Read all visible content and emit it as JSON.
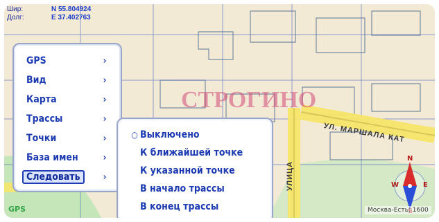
{
  "coords": {
    "lat_label": "Шир:",
    "lat_value": "N 55.804924",
    "lon_label": "Долг:",
    "lon_value": "E 37.402763"
  },
  "map_labels": {
    "district": "СТРОГИНО",
    "street_1": "УЛ. МАРШАЛА КАТ",
    "street_2": "УЛИЦА"
  },
  "menu": {
    "items": [
      {
        "label": "GPS",
        "selected": false
      },
      {
        "label": "Вид",
        "selected": false
      },
      {
        "label": "Карта",
        "selected": false
      },
      {
        "label": "Трассы",
        "selected": false
      },
      {
        "label": "Точки",
        "selected": false
      },
      {
        "label": "База имен",
        "selected": false
      },
      {
        "label": "Следовать",
        "selected": true
      }
    ]
  },
  "submenu": {
    "items": [
      {
        "label": "Выключено",
        "selected": true
      },
      {
        "label": "К ближайшей точке",
        "selected": false
      },
      {
        "label": "К указанной точке",
        "selected": false
      },
      {
        "label": "В начало трассы",
        "selected": false
      },
      {
        "label": "В конец трассы",
        "selected": false
      }
    ]
  },
  "status": {
    "left": "GPS",
    "right": "Москва-Есть: 1600"
  },
  "compass": {
    "north": "N",
    "south": "S",
    "west": "W",
    "east": "E"
  },
  "icons": {
    "menu_arrow": "chevron-right-icon",
    "radio_selected": "radio-selected-icon",
    "compass": "compass-icon"
  },
  "colors": {
    "menu_text": "#1d3bb0",
    "map_background": "#f3ead6",
    "road": "#f6e66a",
    "district_label": "#d34b78"
  }
}
